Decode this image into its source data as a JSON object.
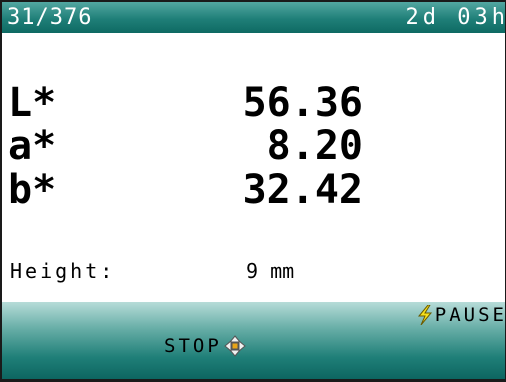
{
  "status_bar": {
    "counter": "31/376",
    "time": "2d 03h"
  },
  "readings": [
    {
      "label": "L*",
      "value": "56.36"
    },
    {
      "label": "a*",
      "value": "8.20"
    },
    {
      "label": "b*",
      "value": "32.42"
    }
  ],
  "height": {
    "label": "Height:",
    "value": "9 mm"
  },
  "softkeys": {
    "pause_label": "PAUSE",
    "stop_label": "STOP"
  },
  "icons": {
    "pause": "lightning-bolt-icon",
    "stop": "four-way-arrow-icon"
  },
  "colors": {
    "accent_teal": "#1f7f78",
    "bolt_yellow": "#f5e11b"
  }
}
